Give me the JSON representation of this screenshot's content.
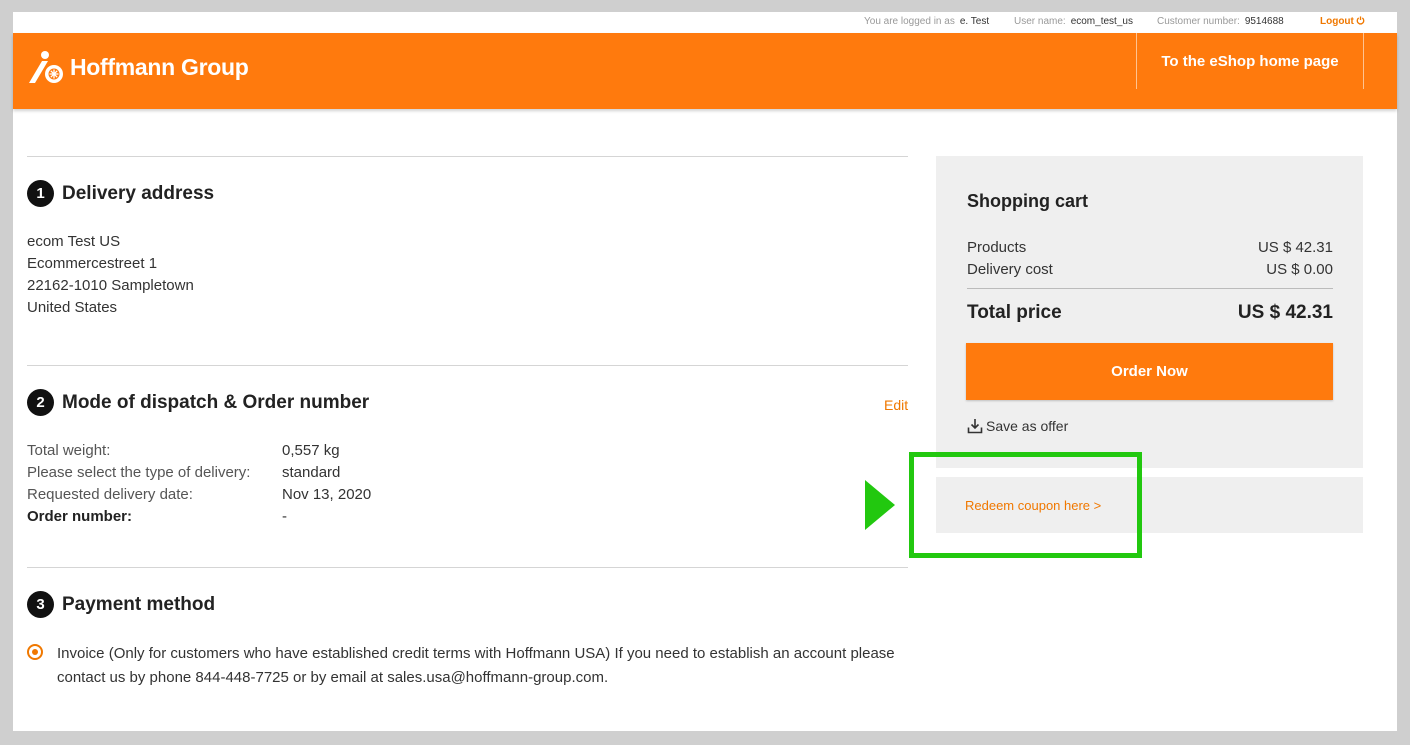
{
  "userbar": {
    "logged_in_label": "You are logged in as",
    "logged_in_value": "e. Test",
    "username_label": "User name:",
    "username_value": "ecom_test_us",
    "customer_label": "Customer number:",
    "customer_value": "9514688",
    "logout_label": "Logout"
  },
  "header": {
    "logo_text": "Hoffmann Group",
    "home_link": "To the eShop home page"
  },
  "delivery": {
    "step": "1",
    "title": "Delivery address",
    "lines": [
      "ecom Test US",
      "Ecommercestreet 1",
      "22162-1010 Sampletown",
      "United States"
    ]
  },
  "dispatch": {
    "step": "2",
    "title": "Mode of dispatch & Order number",
    "edit_label": "Edit",
    "rows": [
      {
        "label": "Total weight:",
        "value": "0,557 kg"
      },
      {
        "label": "Please select the type of delivery:",
        "value": "standard"
      },
      {
        "label": "Requested delivery date:",
        "value": "Nov 13, 2020"
      },
      {
        "label": "Order number:",
        "value": "-"
      }
    ]
  },
  "payment": {
    "step": "3",
    "title": "Payment method",
    "option_text": "Invoice (Only for customers who have established credit terms with Hoffmann USA) If you need to establish an account please contact us by phone 844-448-7725 or by email at sales.usa@hoffmann-group.com."
  },
  "cart": {
    "title": "Shopping cart",
    "products_label": "Products",
    "products_value": "US $ 42.31",
    "delivery_label": "Delivery cost",
    "delivery_value": "US $ 0.00",
    "total_label": "Total price",
    "total_value": "US $ 42.31",
    "order_button": "Order Now",
    "save_offer": "Save as offer"
  },
  "coupon": {
    "link": "Redeem coupon here >"
  },
  "colors": {
    "brand_orange": "#ff7a0d",
    "highlight_green": "#22c80f"
  }
}
